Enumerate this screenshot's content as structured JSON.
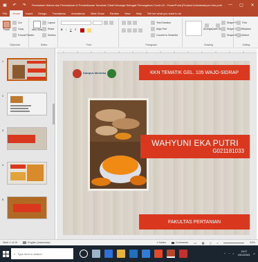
{
  "window": {
    "title": "Perubahan Warna dan Pemanenan & Pemeriksaan Tanaman Obat Keluarga Sebagai Pencegahan Covid-19 - PowerPoint (Product Activation Failed)",
    "user": "wahyuni eka putri",
    "minimize": "—",
    "maximize": "▢",
    "close": "✕"
  },
  "ribbon": {
    "tabs": [
      "File",
      "Home",
      "Insert",
      "Design",
      "Transitions",
      "Animations",
      "Slide Show",
      "Review",
      "View",
      "Help",
      "Tell me what you want to do"
    ],
    "active_tab": "Home",
    "clipboard": {
      "paste": "Paste",
      "cut": "Cut",
      "copy": "Copy",
      "format_painter": "Format Painter",
      "label": "Clipboard"
    },
    "slides": {
      "new_slide": "New Slide",
      "layout": "Layout",
      "reset": "Reset",
      "section": "Section",
      "label": "Slides"
    },
    "font": {
      "label": "Font"
    },
    "paragraph": {
      "text_direction": "Text Direction",
      "align_text": "Align Text",
      "convert": "Convert to SmartArt",
      "label": "Paragraph"
    },
    "drawing": {
      "arrange": "Arrange",
      "quick_styles": "Quick Styles",
      "shape_fill": "Shape Fill",
      "shape_outline": "Shape Outline",
      "shape_effects": "Shape Effects",
      "label": "Drawing"
    },
    "editing": {
      "find": "Find",
      "replace": "Replace",
      "select": "Select",
      "label": "Editing"
    }
  },
  "thumbnails": [
    {
      "num": "1",
      "selected": true
    },
    {
      "num": "2",
      "selected": false
    },
    {
      "num": "3",
      "selected": false
    },
    {
      "num": "4",
      "selected": false
    },
    {
      "num": "5",
      "selected": false
    }
  ],
  "slide": {
    "header": "KKN TEMATIK GEL. 105 WAJO-SIDRAP",
    "name": "WAHYUNI EKA PUTRI",
    "nim": "G021181033",
    "footer": "FAKULTAS PERTANIAN",
    "logo_text": "Kampus Merdeka"
  },
  "status": {
    "slide": "Slide 1 of 15",
    "language": "English (Indonesia)",
    "notes": "Notes",
    "comments": "Comments",
    "zoom": "52%"
  },
  "taskbar": {
    "search_placeholder": "Type here to search",
    "time": "19:27",
    "date": "03/12/2021"
  },
  "colors": {
    "accent": "#b7472a",
    "banner": "#d9381e",
    "taskbar": "#1b2530"
  }
}
